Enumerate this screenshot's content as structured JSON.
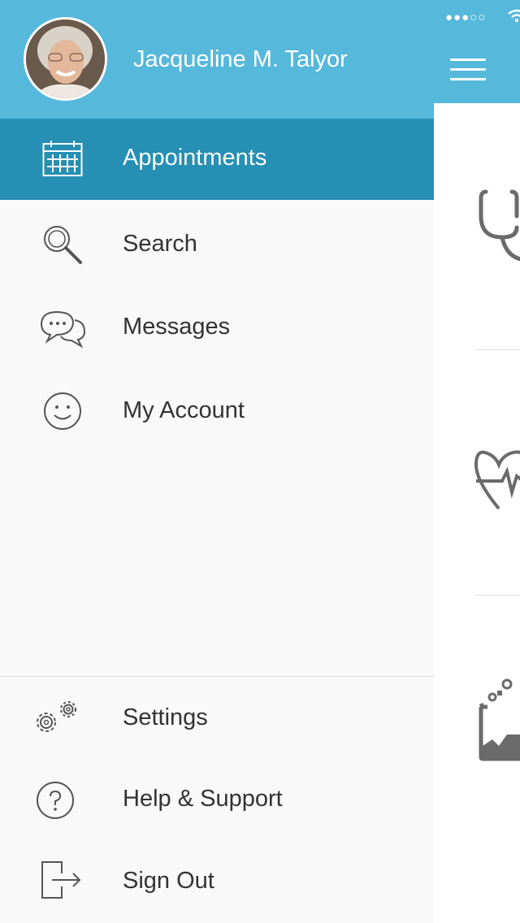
{
  "status_bar": {
    "signal": "●●●○○"
  },
  "profile": {
    "name": "Jacqueline M. Talyor"
  },
  "menu": {
    "appointments": "Appointments",
    "search": "Search",
    "messages": "Messages",
    "account": "My Account",
    "settings": "Settings",
    "help": "Help & Support",
    "signout": "Sign Out"
  },
  "icons": {
    "appointments": "calendar-icon",
    "search": "magnifier-icon",
    "messages": "chat-bubbles-icon",
    "account": "smiley-icon",
    "settings": "gears-icon",
    "help": "question-circle-icon",
    "signout": "sign-out-icon"
  },
  "colors": {
    "header_blue": "#56b8db",
    "active_blue": "#258fb4",
    "drawer_bg": "#f9f9f9",
    "text_dark": "#333333"
  }
}
